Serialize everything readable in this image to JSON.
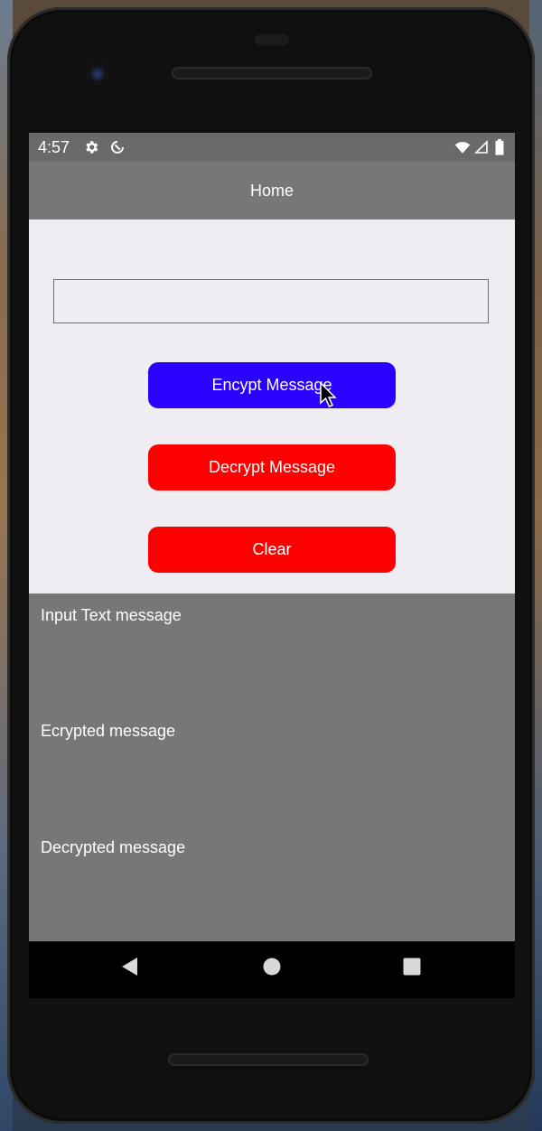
{
  "status_bar": {
    "time": "4:57",
    "left_icons": [
      "gear-icon",
      "data-saver-icon"
    ],
    "right_icons": [
      "wifi-icon",
      "cell-signal-icon",
      "battery-icon"
    ]
  },
  "app_bar": {
    "title": "Home"
  },
  "form": {
    "input_value": "",
    "input_placeholder": ""
  },
  "buttons": {
    "encrypt_label": "Encypt Message",
    "decrypt_label": "Decrypt Message",
    "clear_label": "Clear"
  },
  "results": {
    "input_text_label": "Input Text message",
    "encrypted_label": "Ecrypted message",
    "decrypted_label": "Decrypted message"
  },
  "colors": {
    "encrypt_button": "#2a00ff",
    "decrypt_button": "#ff0000",
    "clear_button": "#ff0000",
    "app_bar": "#787679",
    "content_background": "#efedf1"
  }
}
